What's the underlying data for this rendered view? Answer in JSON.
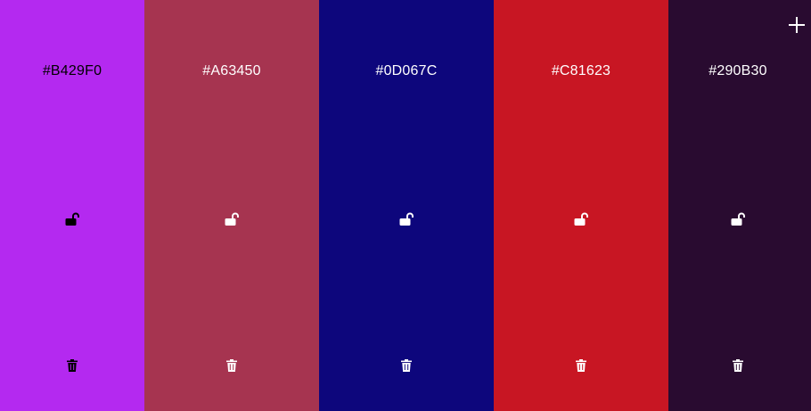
{
  "colors": [
    {
      "hex": "#B429F0",
      "text_color": "#000000",
      "locked": false
    },
    {
      "hex": "#A63450",
      "text_color": "#FFFFFF",
      "locked": false
    },
    {
      "hex": "#0D067C",
      "text_color": "#FFFFFF",
      "locked": false
    },
    {
      "hex": "#C81623",
      "text_color": "#FFFFFF",
      "locked": false
    },
    {
      "hex": "#290B30",
      "text_color": "#FFFFFF",
      "locked": false
    }
  ],
  "icons": {
    "lock": "unlocked-lock-icon",
    "delete": "trash-icon",
    "add": "plus-icon"
  }
}
